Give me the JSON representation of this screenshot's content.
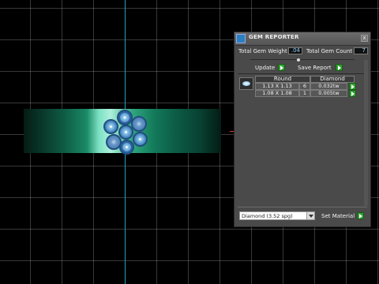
{
  "window": {
    "title": "GEM REPORTER",
    "close_glyph": "x"
  },
  "summary": {
    "total_weight_label": "Total Gem Weight",
    "total_weight_value": ".04",
    "total_count_label": "Total Gem Count",
    "total_count_value": "7"
  },
  "actions": {
    "update_label": "Update",
    "save_report_label": "Save Report"
  },
  "gem_table": {
    "columns": [
      "Round",
      "Diamond"
    ],
    "rows": [
      {
        "size": "1.13 X 1.13",
        "count": "6",
        "weight": "0.032tw"
      },
      {
        "size": "1.08 X 1.08",
        "count": "1",
        "weight": "0.005tw"
      }
    ]
  },
  "material": {
    "selected": "Diamond    (3.52 spg)",
    "set_material_label": "Set Material"
  },
  "colors": {
    "panel": "#4a4a4a",
    "axis": "#1aa6c4",
    "value_text": "#8fd1ff",
    "button_green": "#2fa02f"
  },
  "icons": {
    "window_icon": "gem-reporter-icon",
    "gem_preview": "round-gem-icon",
    "action_arrow": "play-arrow-icon"
  }
}
